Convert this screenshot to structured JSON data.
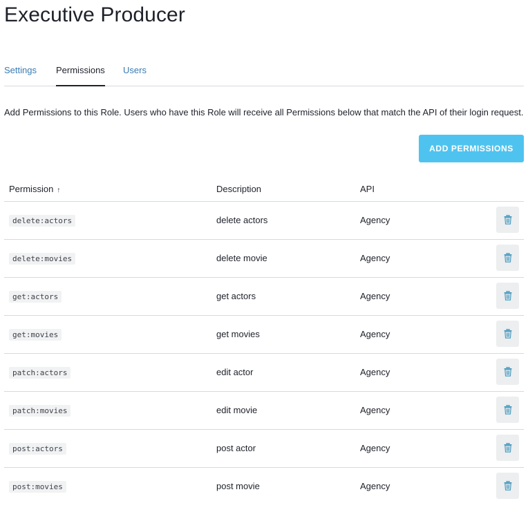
{
  "page": {
    "title": "Executive Producer",
    "description": "Add Permissions to this Role. Users who have this Role will receive all Permissions below that match the API of their login request."
  },
  "tabs": [
    {
      "label": "Settings",
      "active": false
    },
    {
      "label": "Permissions",
      "active": true
    },
    {
      "label": "Users",
      "active": false
    }
  ],
  "actions": {
    "add_permissions_label": "ADD PERMISSIONS"
  },
  "table": {
    "headers": {
      "permission": "Permission",
      "permission_sort": "↑",
      "description": "Description",
      "api": "API"
    },
    "rows": [
      {
        "permission": "delete:actors",
        "description": "delete actors",
        "api": "Agency"
      },
      {
        "permission": "delete:movies",
        "description": "delete movie",
        "api": "Agency"
      },
      {
        "permission": "get:actors",
        "description": "get actors",
        "api": "Agency"
      },
      {
        "permission": "get:movies",
        "description": "get movies",
        "api": "Agency"
      },
      {
        "permission": "patch:actors",
        "description": "edit actor",
        "api": "Agency"
      },
      {
        "permission": "patch:movies",
        "description": "edit movie",
        "api": "Agency"
      },
      {
        "permission": "post:actors",
        "description": "post actor",
        "api": "Agency"
      },
      {
        "permission": "post:movies",
        "description": "post movie",
        "api": "Agency"
      }
    ]
  },
  "icons": {
    "row_action": "trash-icon",
    "sort": "arrow-up-icon"
  },
  "colors": {
    "accent_button": "#4fc3ef",
    "link": "#3a7ab0",
    "trash_icon": "#4a9bc0",
    "trash_button_bg": "#eceeef",
    "code_bg": "#f1f2f3"
  }
}
